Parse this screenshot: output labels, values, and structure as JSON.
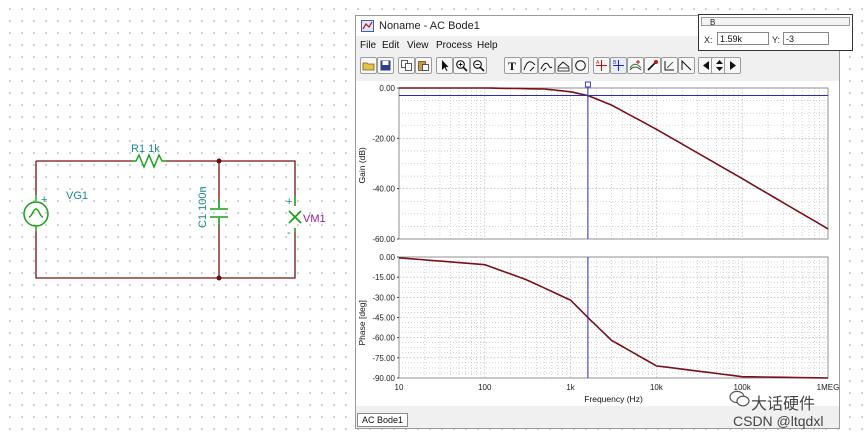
{
  "schematic": {
    "r1_label": "R1 1k",
    "c1_label": "C1 100n",
    "vg1_label": "VG1",
    "vm1_label": "VM1",
    "plus": "+",
    "minus": "-"
  },
  "window": {
    "title": "Noname - AC Bode1",
    "menu": [
      "File",
      "Edit",
      "View",
      "Process",
      "Help"
    ],
    "toolbar_icons": [
      "open-folder-icon",
      "save-disk-icon",
      "copy-icon",
      "paste-icon",
      "pointer-arrow-icon",
      "zoom-in-icon",
      "zoom-out-icon",
      "text-tool-icon",
      "curve-tool-icon",
      "pen-tool-icon",
      "polyline-tool-icon",
      "ellipse-tool-icon",
      "cursor-a-icon",
      "cursor-b-icon",
      "curve-marker-icon",
      "probe-icon",
      "grid-icon",
      "angle-icon",
      "arrow-left-icon",
      "arrow-updown-icon",
      "arrow-right-icon"
    ],
    "status_tab": "AC Bode1"
  },
  "cursor": {
    "group": "B",
    "x_label": "X:",
    "x_value": "1.59k",
    "y_label": "Y:",
    "y_value": "-3"
  },
  "chart_data": [
    {
      "type": "line",
      "title": "",
      "xlabel": "",
      "ylabel": "Gain (dB)",
      "x_scale": "log",
      "xlim": [
        10,
        1000000
      ],
      "ylim": [
        -60,
        0
      ],
      "y_ticks": [
        "0.00",
        "-20.00",
        "-40.00",
        "-60.00"
      ],
      "grid": true,
      "series": [
        {
          "color": "#7b0f1a",
          "x": [
            10,
            100,
            500,
            1000,
            1590,
            3000,
            10000,
            100000,
            1000000
          ],
          "y": [
            0,
            0,
            -0.4,
            -1.5,
            -3,
            -6.8,
            -16.4,
            -36,
            -56
          ]
        }
      ],
      "cursor_x": 1590
    },
    {
      "type": "line",
      "title": "",
      "xlabel": "Frequency (Hz)",
      "ylabel": "Phase [deg]",
      "x_scale": "log",
      "xlim": [
        10,
        1000000
      ],
      "ylim": [
        -90,
        0
      ],
      "x_ticks": [
        "10",
        "100",
        "1k",
        "10k",
        "100k",
        "1MEG"
      ],
      "y_ticks": [
        "0.00",
        "-15.00",
        "-30.00",
        "-45.00",
        "-60.00",
        "-75.00",
        "-90.00"
      ],
      "grid": true,
      "series": [
        {
          "color": "#7b0f1a",
          "x": [
            10,
            100,
            300,
            1000,
            1590,
            3000,
            10000,
            100000,
            1000000
          ],
          "y": [
            -0.6,
            -5.7,
            -16.7,
            -32.1,
            -45,
            -62,
            -81,
            -89,
            -90
          ]
        }
      ],
      "cursor_x": 1590
    }
  ],
  "watermark": {
    "name": "大话硬件",
    "csdn": "CSDN @ltqdxl"
  },
  "colors": {
    "trace": "#7b0f1a",
    "cursor": "#2b2bb8",
    "grid": "#b9b9b9",
    "wire": "#7a1111",
    "component": "#15a115",
    "label_teal": "#1a8a8a",
    "label_purple": "#9a1a9a"
  }
}
